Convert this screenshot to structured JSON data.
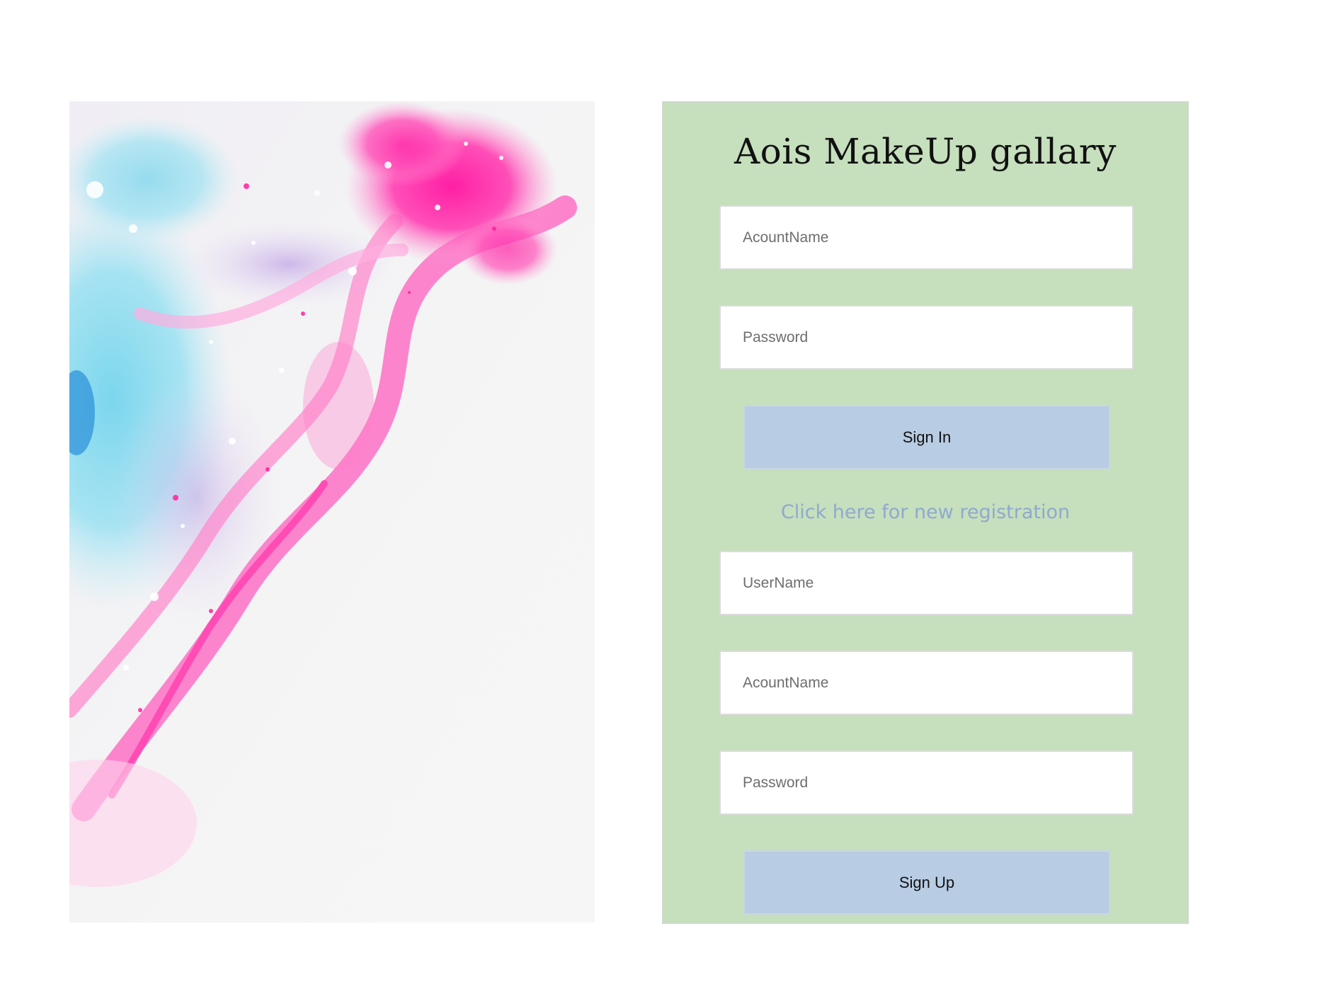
{
  "hero": {
    "alt": "abstract pink and blue fluid paint"
  },
  "login": {
    "title": "Aois MakeUp gallary",
    "account_placeholder": "AcountName",
    "password_placeholder": "Password",
    "sign_in_label": "Sign In"
  },
  "registration": {
    "link_text": "Click here for new registration",
    "username_placeholder": "UserName",
    "account_placeholder": "AcountName",
    "password_placeholder": "Password",
    "sign_up_label": "Sign Up"
  },
  "colors": {
    "panel_background": "#c6dfbd",
    "button_background": "#b8cce3",
    "link_color": "#8fa9cf"
  }
}
